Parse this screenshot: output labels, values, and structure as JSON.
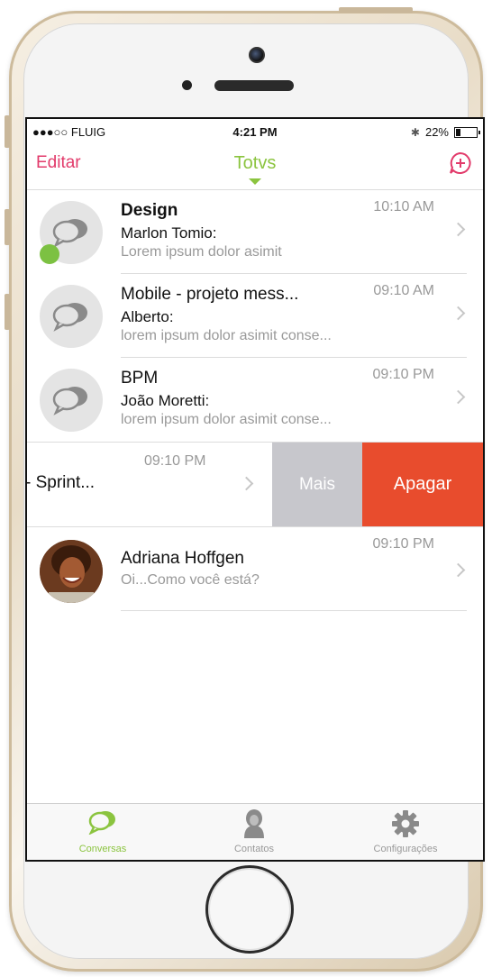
{
  "status_bar": {
    "carrier": "●●●○○ FLUIG",
    "time": "4:21 PM",
    "battery": "22%"
  },
  "nav": {
    "left": "Editar",
    "title": "Totvs"
  },
  "conversations": [
    {
      "title": "Design",
      "sender": "Marlon Tomio:",
      "preview": "Lorem ipsum dolor asimit",
      "time": "10:10 AM"
    },
    {
      "title": "Mobile - projeto mess...",
      "sender": "Alberto:",
      "preview": "lorem ipsum dolor asimit conse...",
      "time": "09:10 AM"
    },
    {
      "title": "BPM",
      "sender": "João Moretti:",
      "preview": "lorem ipsum dolor asimit conse...",
      "time": "09:10 PM"
    }
  ],
  "swiped_row": {
    "title": "- Sprint...",
    "time": "09:10 PM",
    "more_label": "Mais",
    "delete_label": "Apagar"
  },
  "contact_row": {
    "name": "Adriana Hoffgen",
    "preview": "Oi...Como você está?",
    "time": "09:10 PM"
  },
  "tabs": [
    {
      "label": "Conversas"
    },
    {
      "label": "Contatos"
    },
    {
      "label": "Configurações"
    }
  ],
  "colors": {
    "accent_green": "#8bc43f",
    "accent_pink": "#e23b6b",
    "delete_red": "#e84c2d"
  }
}
